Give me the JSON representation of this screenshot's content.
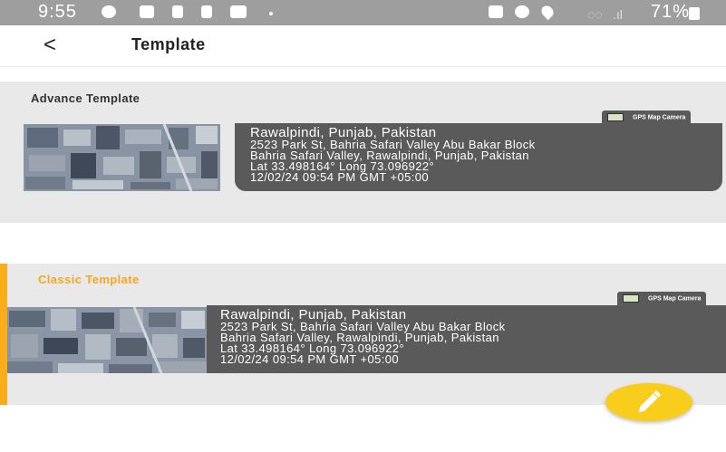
{
  "status_bar": {
    "time": "9:55",
    "battery": "71%",
    "icons": [
      "facebook-icon",
      "youtube-icon",
      "tiktok-icon",
      "tiktok-icon",
      "bag-icon",
      "alarm-icon",
      "location-icon",
      "wifi-icon",
      "signal-icon",
      "battery-icon"
    ]
  },
  "appbar": {
    "back_glyph": "<",
    "title": "Template"
  },
  "templates": [
    {
      "title": "Advance Template",
      "selected": false,
      "badge": "GPS Map Camera",
      "lines": [
        "Rawalpindi, Punjab, Pakistan",
        "2523 Park St, Bahria Safari Valley Abu Bakar Block",
        "Bahria Safari Valley, Rawalpindi, Punjab, Pakistan",
        "Lat 33.498164° Long 73.096922°",
        "12/02/24 09:54 PM GMT +05:00"
      ]
    },
    {
      "title": "Classic Template",
      "selected": true,
      "badge": "GPS Map Camera",
      "lines": [
        "Rawalpindi, Punjab, Pakistan",
        "2523 Park St, Bahria Safari Valley Abu Bakar Block",
        "Bahria Safari Valley, Rawalpindi, Punjab, Pakistan",
        "Lat 33.498164° Long 73.096922°",
        "12/02/24 09:54 PM GMT +05:00"
      ]
    }
  ],
  "fab": {
    "icon": "pencil-icon"
  },
  "colors": {
    "accent": "#f7ad1c",
    "fab": "#f8cd1b",
    "card": "#5a5a5a",
    "section_bg": "#e9e9e9"
  }
}
